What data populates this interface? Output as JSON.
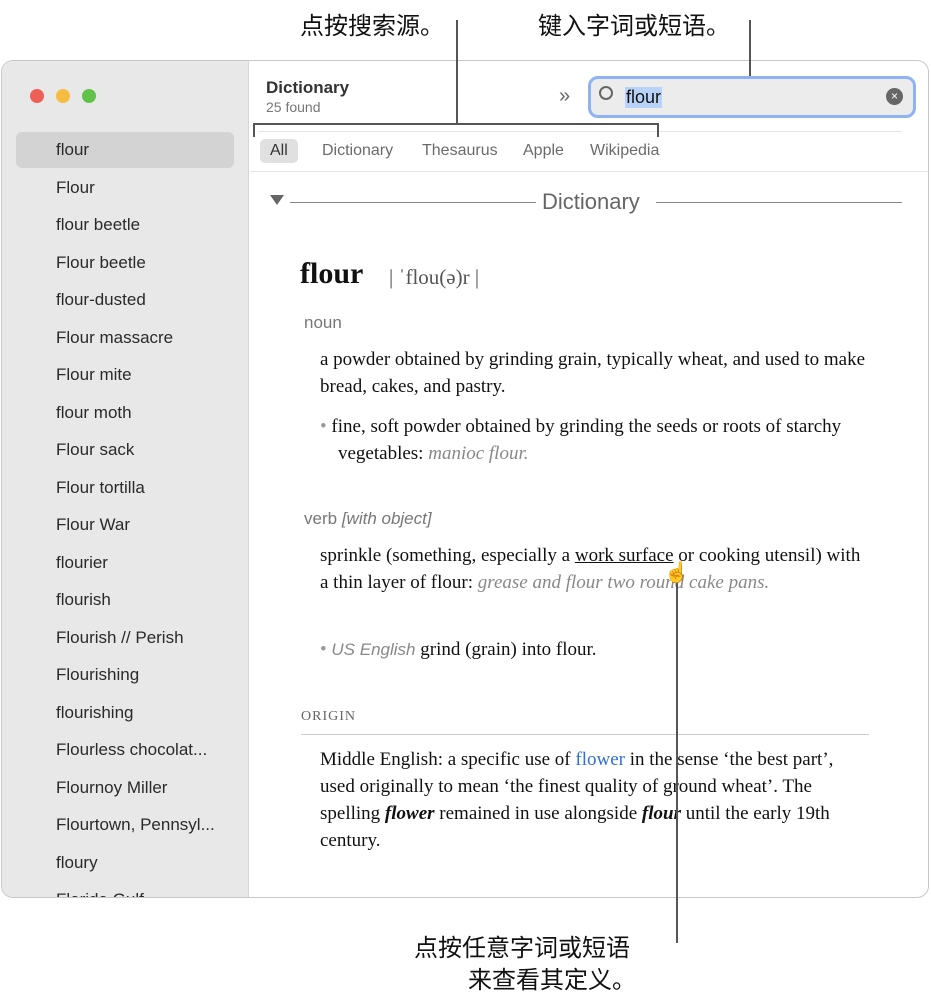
{
  "callouts": {
    "source": "点按搜索源。",
    "type": "键入字词或短语。",
    "click1": "点按任意字词或短语",
    "click2": "来查看其定义。"
  },
  "header": {
    "title": "Dictionary",
    "count": "25 found",
    "forward_icon": "double-chevron-right-icon"
  },
  "search": {
    "value": "flour",
    "icon": "magnifier-icon",
    "clear_icon": "clear-circle-icon"
  },
  "tabs": [
    "All",
    "Dictionary",
    "Thesaurus",
    "Apple",
    "Wikipedia"
  ],
  "sidebar": {
    "items": [
      "flour",
      "Flour",
      "flour beetle",
      "Flour beetle",
      "flour-dusted",
      "Flour massacre",
      "Flour mite",
      "flour moth",
      "Flour sack",
      "Flour tortilla",
      "Flour War",
      "flourier",
      "flourish",
      "Flourish // Perish",
      "Flourishing",
      "flourishing",
      "Flourless chocolat...",
      "Flournoy Miller",
      "Flourtown, Pennsyl...",
      "floury",
      "Florida Gulf"
    ]
  },
  "entry": {
    "section": "Dictionary",
    "headword": "flour",
    "pron": "| ˈflou(ə)r |",
    "noun_label": "noun",
    "noun_def": "a powder obtained by grinding grain, typically wheat, and used to make bread, cakes, and pastry.",
    "noun_sub": "fine, soft powder obtained by grinding the seeds or roots of starchy vegetables:",
    "noun_sub_ex": "manioc flour.",
    "verb_label": "verb",
    "verb_tag": "[with object]",
    "verb_def1": "sprinkle (something, especially a ",
    "verb_link": "work surface",
    "verb_def2": " or cooking utensil) with a thin layer of flour:",
    "verb_ex": "grease and flour two round cake pans.",
    "verb_sub_reg": "US English",
    "verb_sub": "grind (grain) into flour.",
    "origin_label": "ORIGIN",
    "origin1": "Middle English: a specific use of ",
    "origin_link": "flower",
    "origin2": " in the sense ‘the best part’, used originally to mean ‘the finest quality of ground wheat’. The spelling ",
    "origin_bold1": "flower",
    "origin3": " remained in use alongside ",
    "origin_bold2": "flour",
    "origin4": " until the early 19th century."
  },
  "colors": {
    "accent": "#2f6fdc",
    "focus": "#8fb2f2"
  }
}
